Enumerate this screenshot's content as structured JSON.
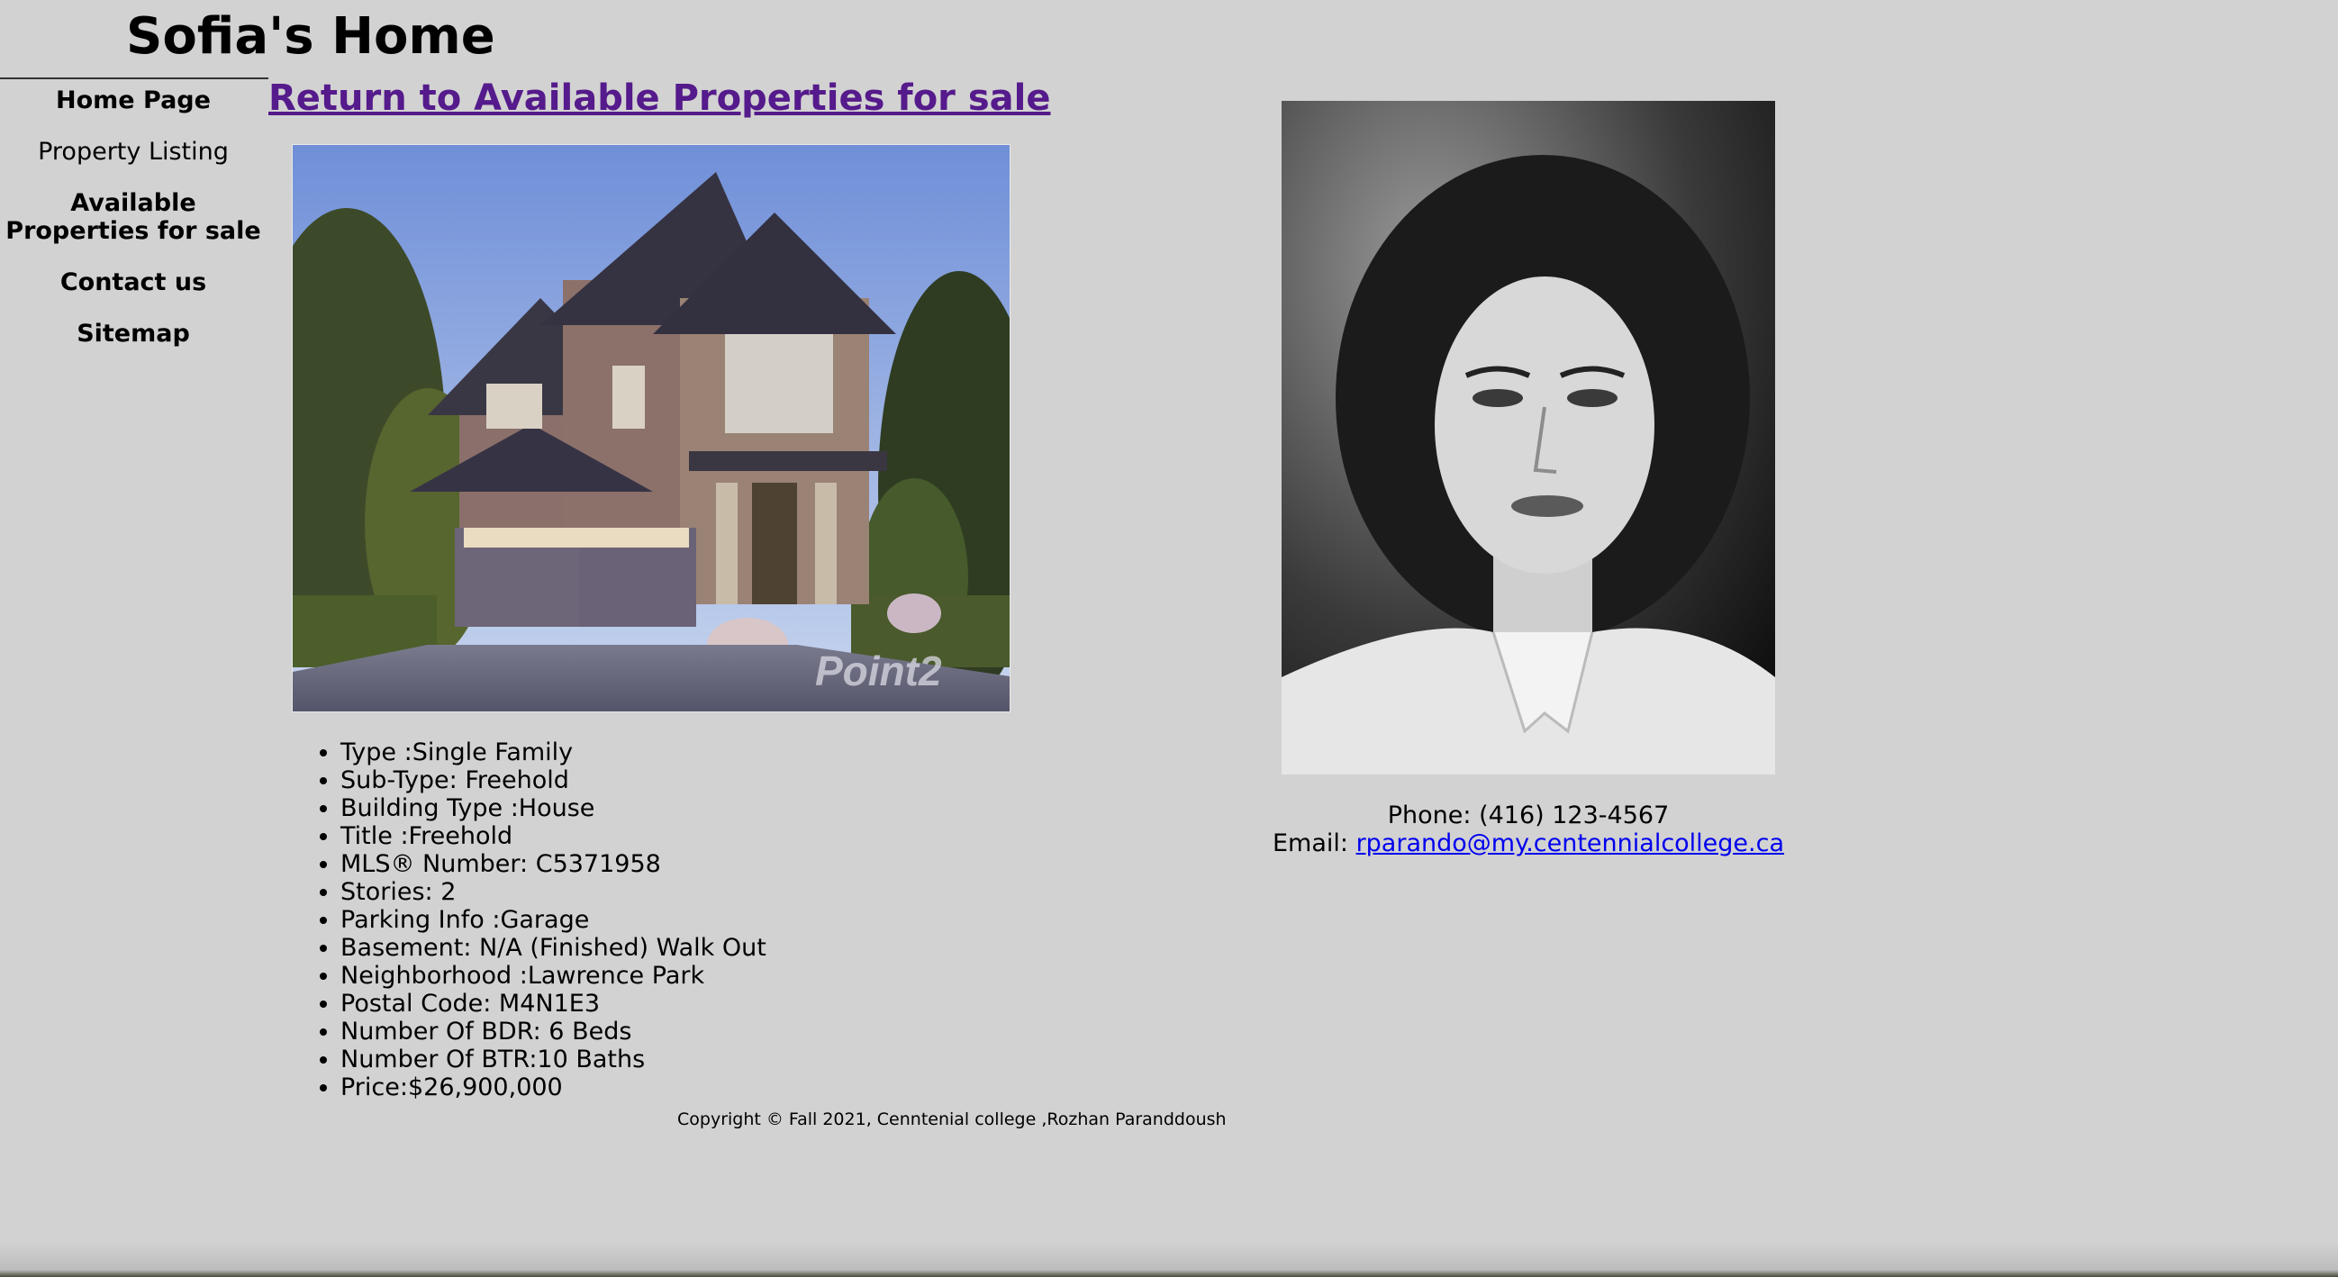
{
  "header": {
    "site_title": "Sofia's Home"
  },
  "sidebar": {
    "items": [
      {
        "label": "Home Page"
      },
      {
        "label": "Property Listing"
      },
      {
        "label": "Available Properties for sale"
      },
      {
        "label": "Contact us"
      },
      {
        "label": "Sitemap"
      }
    ]
  },
  "main": {
    "return_link": "Return to Available Properties for sale",
    "photo_watermark": "Point2",
    "details": [
      "Type :Single Family",
      "Sub-Type: Freehold",
      "Building Type :House",
      "Title :Freehold",
      "MLS® Number: C5371958",
      "Stories: 2",
      "Parking Info :Garage",
      "Basement: N/A (Finished) Walk Out",
      "Neighborhood :Lawrence Park",
      "Postal Code: M4N1E3",
      "Number Of BDR: 6 Beds",
      "Number Of BTR:10 Baths",
      "Price:$26,900,000"
    ]
  },
  "contact": {
    "phone_text": "Phone: (416) 123-4567",
    "email_label": "Email: ",
    "email": "rparando@my.centennialcollege.ca"
  },
  "footer": {
    "copyright": "Copyright © Fall 2021, Cenntenial college ,Rozhan Paranddoush"
  },
  "colors": {
    "background": "#d2d2d2",
    "visited_link": "#551a8b",
    "link": "#0000ee"
  }
}
